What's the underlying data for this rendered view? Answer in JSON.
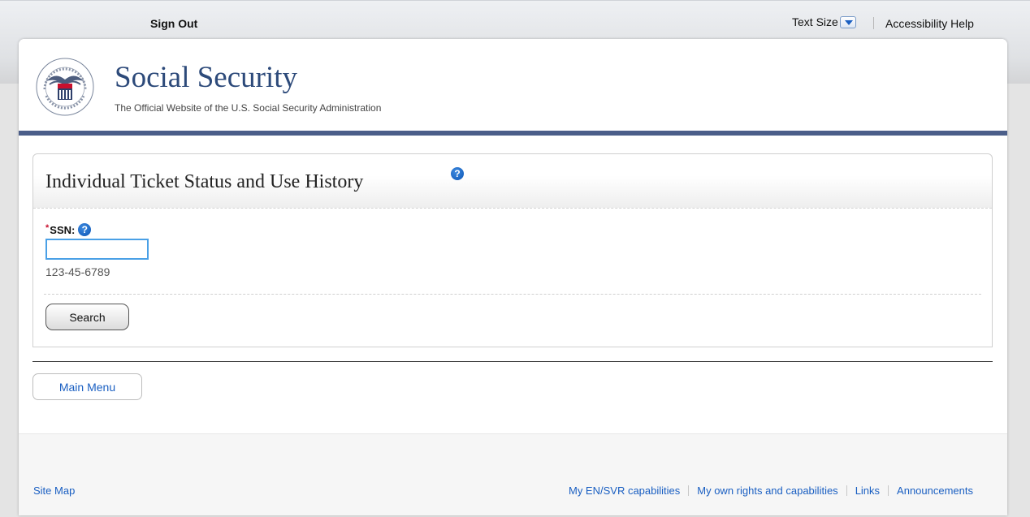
{
  "utility": {
    "sign_out": "Sign Out",
    "text_size": "Text Size",
    "accessibility_help": "Accessibility Help"
  },
  "header": {
    "seal_icon": "ssa-seal-icon",
    "title": "Social Security",
    "subtitle": "The Official Website of the U.S. Social Security Administration"
  },
  "panel": {
    "title": "Individual Ticket Status and Use History",
    "help_icon": "question-circle-icon",
    "ssn_required_marker": "*",
    "ssn_label": "SSN:",
    "ssn_value": "",
    "ssn_hint": "123-45-6789",
    "search_label": "Search"
  },
  "nav": {
    "main_menu_label": "Main Menu"
  },
  "footer": {
    "site_map": "Site Map",
    "links": [
      "My EN/SVR capabilities",
      "My own rights and capabilities",
      "Links",
      "Announcements"
    ]
  },
  "colors": {
    "brand_blue": "#2d4a7a",
    "header_rule": "#4b5e89",
    "link_blue": "#1a5fc2",
    "required_red": "#c8102e",
    "input_focus": "#4aa0e6"
  }
}
